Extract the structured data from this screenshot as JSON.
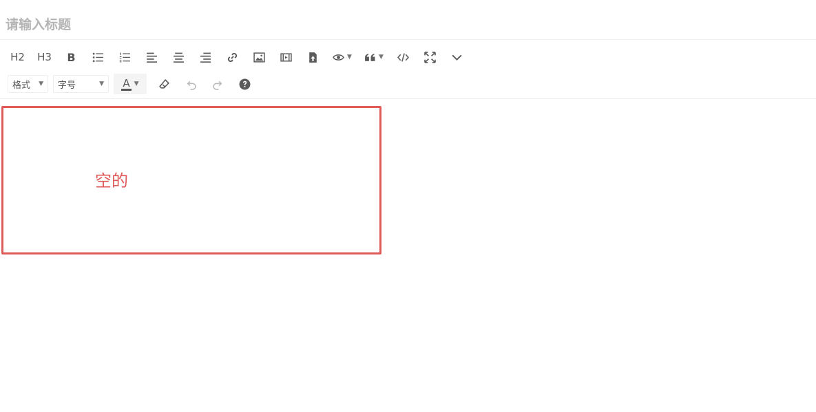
{
  "title": {
    "placeholder": "请输入标题",
    "value": ""
  },
  "toolbar": {
    "h2": "H2",
    "h3": "H3",
    "bold": "B",
    "icons": [
      "bulleted-list-icon",
      "numbered-list-icon",
      "align-left-icon",
      "align-center-icon",
      "align-right-icon",
      "link-icon",
      "image-icon",
      "video-icon",
      "file-upload-icon",
      "eye-icon",
      "quote-icon",
      "code-icon",
      "fullscreen-icon",
      "chevron-down-icon",
      "eraser-icon",
      "undo-icon",
      "redo-icon",
      "help-icon"
    ],
    "format_select": "格式",
    "size_select": "字号",
    "font_color": "A"
  },
  "content": {
    "note": "空的"
  },
  "colors": {
    "highlight": "#e05a5a",
    "icon": "#5b5b5b",
    "placeholder": "#b5b5b5"
  }
}
